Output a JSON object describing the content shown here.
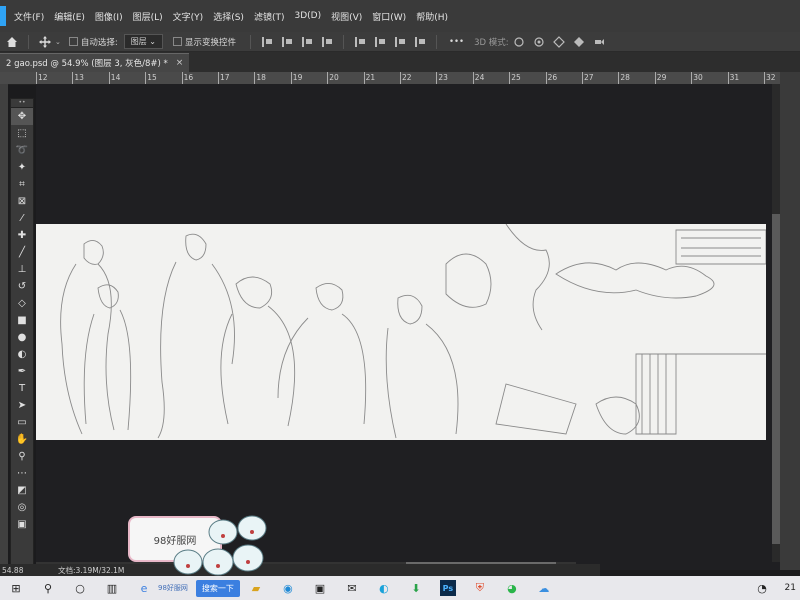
{
  "menu": {
    "items": [
      "文件(F)",
      "编辑(E)",
      "图像(I)",
      "图层(L)",
      "文字(Y)",
      "选择(S)",
      "滤镜(T)",
      "3D(D)",
      "视图(V)",
      "窗口(W)",
      "帮助(H)"
    ]
  },
  "options": {
    "auto_select_label": "自动选择:",
    "auto_select_value": "图层",
    "show_transform_label": "显示变换控件",
    "more_label": "•••",
    "mode_3d_label": "3D 模式:"
  },
  "document": {
    "tab_title": "2  gao.psd @ 54.9% (图层 3, 灰色/8#) *",
    "close_glyph": "×"
  },
  "ruler": {
    "labels": [
      "12",
      "13",
      "14",
      "15",
      "16",
      "17",
      "18",
      "19",
      "20",
      "21",
      "22",
      "23",
      "24",
      "25",
      "26",
      "27",
      "28",
      "29",
      "30",
      "31",
      "32",
      "33"
    ]
  },
  "status": {
    "zoom": "54.88",
    "doc_info": "文档:3.19M/32.1M"
  },
  "taskbar": {
    "search_label": "搜索一下",
    "edge_text": "98好服网",
    "ps_label": "Ps",
    "clock": "21"
  },
  "watermark": {
    "text": "98好服网"
  },
  "colors": {
    "app_bg": "#1b1b1d",
    "panel": "#3a3a3a",
    "canvas": "#f2f2f0",
    "line_art": "#8a8a8a",
    "accent": "#2fa3f5"
  }
}
